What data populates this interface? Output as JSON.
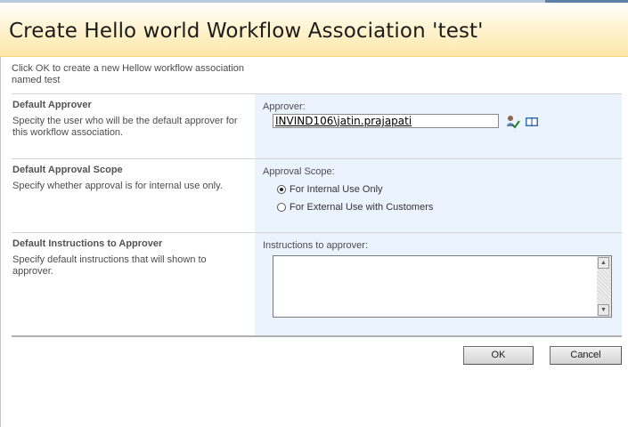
{
  "dialog": {
    "title": "Create Hello world Workflow Association 'test'",
    "intro": "Click OK to create a new Hellow workflow association named test"
  },
  "sections": {
    "approver": {
      "heading": "Default Approver",
      "description": "Specity the user who will be the default approver for this workflow association.",
      "field_label": "Approver:",
      "value": "INVIND106\\jatin.prajapati",
      "icons": [
        "check-names-icon",
        "address-book-icon"
      ]
    },
    "scope": {
      "heading": "Default Approval Scope",
      "description": "Specify whether approval is for internal use only.",
      "field_label": "Approval Scope:",
      "options": [
        {
          "label": "For Internal Use Only",
          "selected": true
        },
        {
          "label": "For External Use with Customers",
          "selected": false
        }
      ]
    },
    "instructions": {
      "heading": "Default Instructions to Approver",
      "description": "Specify default instructions that will shown to approver.",
      "field_label": "Instructions to approver:",
      "value": ""
    }
  },
  "buttons": {
    "ok": "OK",
    "cancel": "Cancel"
  },
  "colors": {
    "banner": "#fde7a8",
    "field_panel": "#ebf3ff"
  }
}
